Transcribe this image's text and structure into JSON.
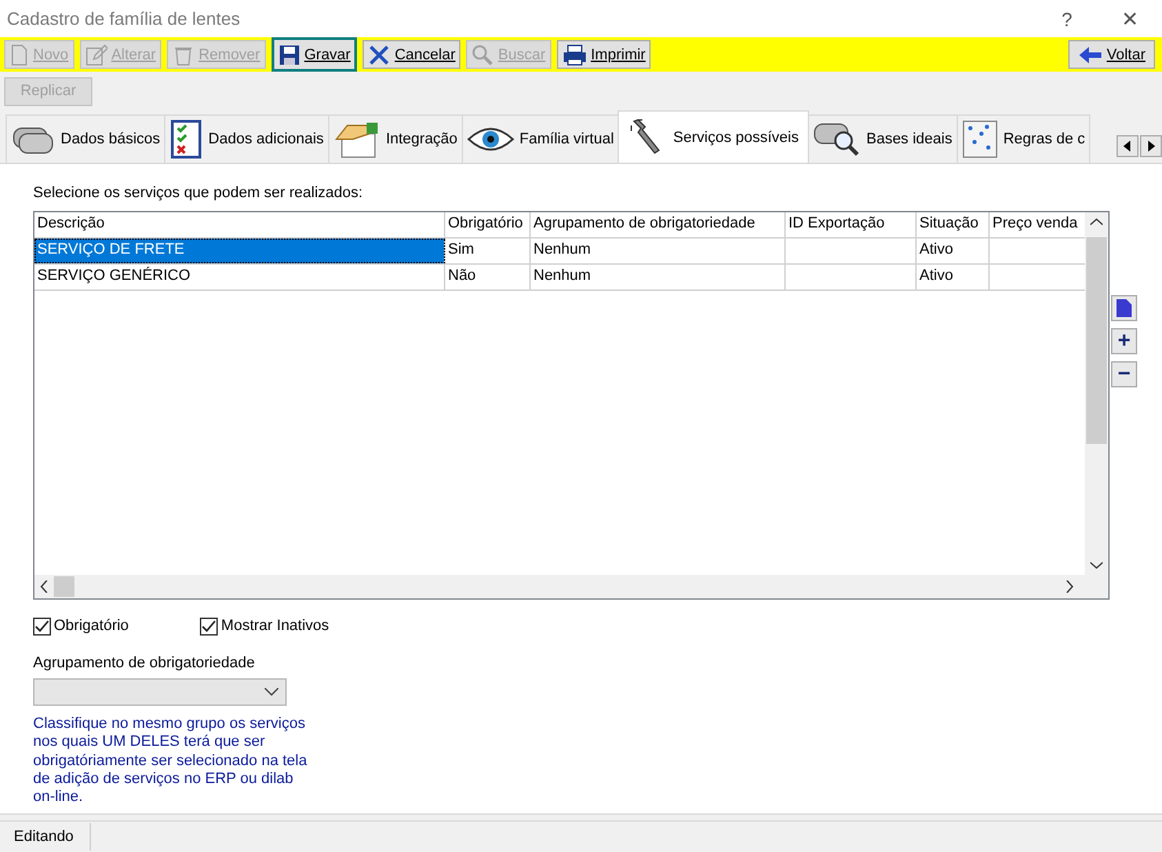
{
  "window": {
    "title": "Cadastro de família de lentes",
    "help": "?",
    "close": "✕"
  },
  "toolbar": [
    {
      "label": "Novo",
      "kind": "new",
      "disabled": true,
      "focused": false
    },
    {
      "label": "Alterar",
      "kind": "edit",
      "disabled": true,
      "focused": false
    },
    {
      "label": "Remover",
      "kind": "delete",
      "disabled": true,
      "focused": false
    },
    {
      "label": "Gravar",
      "kind": "save",
      "disabled": false,
      "focused": true
    },
    {
      "label": "Cancelar",
      "kind": "cancel",
      "disabled": false,
      "focused": false
    },
    {
      "label": "Buscar",
      "kind": "search",
      "disabled": true,
      "focused": false
    },
    {
      "label": "Imprimir",
      "kind": "print",
      "disabled": false,
      "focused": false
    }
  ],
  "back_button": {
    "label": "Voltar"
  },
  "replicate_button": {
    "label": "Replicar",
    "disabled": true
  },
  "tabs": [
    {
      "label": "Dados básicos",
      "kind": "basic",
      "selected": false
    },
    {
      "label": "Dados adicionais",
      "kind": "checklist",
      "selected": false
    },
    {
      "label": "Integração",
      "kind": "handshake",
      "selected": false
    },
    {
      "label": "Família virtual",
      "kind": "eye",
      "selected": false
    },
    {
      "label": "Serviços possíveis",
      "kind": "wrench",
      "selected": true
    },
    {
      "label": "Bases ideais",
      "kind": "lens-search",
      "selected": false
    },
    {
      "label": "Regras de c",
      "kind": "dots",
      "selected": false
    }
  ],
  "instruction": "Selecione os serviços que podem ser realizados:",
  "table": {
    "columns": [
      "Descrição",
      "Obrigatório",
      "Agrupamento de obrigatoriedade",
      "ID Exportação",
      "Situação",
      "Preço venda"
    ],
    "rows": [
      {
        "cells": [
          "SERVIÇO DE FRETE",
          "Sim",
          "Nenhum",
          "",
          "Ativo",
          ""
        ],
        "selected": true
      },
      {
        "cells": [
          "SERVIÇO GENÉRICO",
          "Não",
          "Nenhum",
          "",
          "Ativo",
          ""
        ],
        "selected": false
      }
    ]
  },
  "side_buttons": [
    {
      "kind": "document"
    },
    {
      "kind": "add",
      "label": "+"
    },
    {
      "kind": "remove",
      "label": "−"
    }
  ],
  "checkboxes": [
    {
      "label": "Obrigatório",
      "checked": true
    },
    {
      "label": "Mostrar Inativos",
      "checked": true
    }
  ],
  "grouping": {
    "label": "Agrupamento de obrigatoriedade",
    "disabled": true,
    "help": "Classifique no mesmo grupo os serviços nos quais UM DELES terá que ser obrigatóriamente ser selecionado na tela de adição de serviços no ERP ou dilab on-line."
  },
  "status_bar": {
    "text": "Editando"
  }
}
